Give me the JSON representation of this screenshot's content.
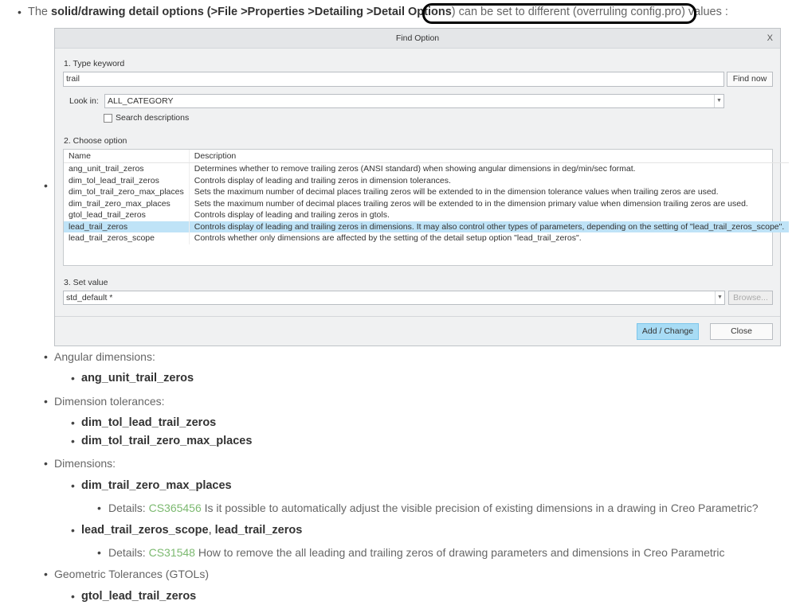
{
  "intro": {
    "prefix": "The",
    "bold": "solid/drawing detail options (>File >Properties >Detailing >Detail Options",
    "suffix": ") can be set to different (overruling config.pro) values :"
  },
  "dialog": {
    "title": "Find Option",
    "close": "X",
    "step1": "1. Type keyword",
    "keyword": "trail",
    "find_now": "Find now",
    "look_in_label": "Look in:",
    "look_in_value": "ALL_CATEGORY",
    "search_desc": "Search descriptions",
    "step2": "2. Choose option",
    "columns": [
      "Name",
      "Description"
    ],
    "rows": [
      {
        "name": "ang_unit_trail_zeros",
        "desc": "Determines whether to remove trailing zeros (ANSI standard) when showing angular dimensions in deg/min/sec format."
      },
      {
        "name": "dim_tol_lead_trail_zeros",
        "desc": "Controls display of leading and trailing zeros in dimension tolerances."
      },
      {
        "name": "dim_tol_trail_zero_max_places",
        "desc": "Sets the maximum number of decimal places trailing zeros will be extended to in the dimension tolerance values when trailing zeros are used."
      },
      {
        "name": "dim_trail_zero_max_places",
        "desc": "Sets the maximum number of decimal places trailing zeros will be extended to in the dimension primary value when dimension trailing zeros are used."
      },
      {
        "name": "gtol_lead_trail_zeros",
        "desc": "Controls display of leading and trailing zeros in gtols."
      },
      {
        "name": "lead_trail_zeros",
        "desc": "Controls display of leading and trailing zeros in dimensions. It may also control other types of parameters, depending on the setting of \"lead_trail_zeros_scope\"."
      },
      {
        "name": "lead_trail_zeros_scope",
        "desc": "Controls whether only dimensions are affected by the setting of the detail setup option \"lead_trail_zeros\"."
      }
    ],
    "selected_row": 5,
    "step3": "3. Set value",
    "value": "std_default *",
    "browse": "Browse...",
    "add_change": "Add / Change",
    "close_btn": "Close"
  },
  "list": {
    "angular": "Angular dimensions:",
    "ang_item": "ang_unit_trail_zeros",
    "tol": "Dimension tolerances:",
    "tol_item1": "dim_tol_lead_trail_zeros",
    "tol_item2": "dim_tol_trail_zero_max_places",
    "dims": "Dimensions:",
    "dim_item1": "dim_trail_zero_max_places",
    "details_label": "Details:",
    "cs1": "CS365456",
    "cs1_text": "Is it possible to automatically adjust the visible precision of existing dimensions in a drawing in Creo Parametric?",
    "dim_item2a": "lead_trail_zeros_scope",
    "sep": ",",
    "dim_item2b": "lead_trail_zeros",
    "cs2": "CS31548",
    "cs2_text": "How to remove the all leading and trailing zeros of drawing parameters and dimensions in Creo Parametric",
    "gtol": "Geometric Tolerances (GTOLs)",
    "gtol_item": "gtol_lead_trail_zeros"
  },
  "colors": {
    "selected": "#bfe3f7",
    "primary_button": "#a8dcf5",
    "link": "#7cb970"
  }
}
